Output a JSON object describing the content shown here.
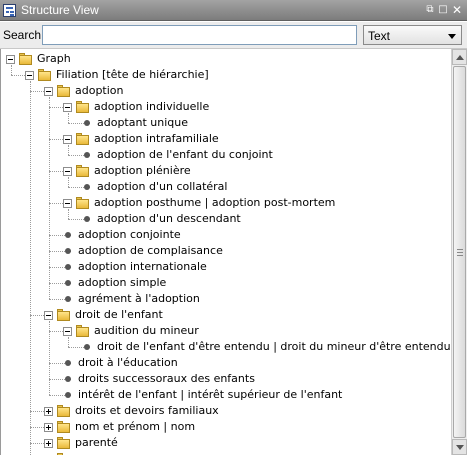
{
  "window": {
    "title": "Structure View"
  },
  "search": {
    "label": "Search",
    "value": "",
    "type_select": "Text"
  },
  "tree": [
    {
      "label": "Graph",
      "kind": "folder",
      "level": 0,
      "expander": "expanded"
    },
    {
      "label": "Filiation [tête de hiérarchie]",
      "kind": "folder",
      "level": 1,
      "expander": "expanded"
    },
    {
      "label": "adoption",
      "kind": "folder",
      "level": 2,
      "expander": "expanded"
    },
    {
      "label": "adoption individuelle",
      "kind": "folder",
      "level": 3,
      "expander": "expanded"
    },
    {
      "label": "adoptant unique",
      "kind": "leaf",
      "level": 4
    },
    {
      "label": "adoption intrafamiliale",
      "kind": "folder",
      "level": 3,
      "expander": "expanded"
    },
    {
      "label": "adoption de l'enfant du conjoint",
      "kind": "leaf",
      "level": 4
    },
    {
      "label": "adoption plénière",
      "kind": "folder",
      "level": 3,
      "expander": "expanded"
    },
    {
      "label": "adoption d'un collatéral",
      "kind": "leaf",
      "level": 4
    },
    {
      "label": "adoption posthume | adoption post-mortem",
      "kind": "folder",
      "level": 3,
      "expander": "expanded"
    },
    {
      "label": "adoption d'un descendant",
      "kind": "leaf",
      "level": 4
    },
    {
      "label": "adoption conjointe",
      "kind": "leaf",
      "level": 3
    },
    {
      "label": "adoption de complaisance",
      "kind": "leaf",
      "level": 3
    },
    {
      "label": "adoption internationale",
      "kind": "leaf",
      "level": 3
    },
    {
      "label": "adoption simple",
      "kind": "leaf",
      "level": 3
    },
    {
      "label": "agrément à l'adoption",
      "kind": "leaf",
      "level": 3
    },
    {
      "label": "droit de l'enfant",
      "kind": "folder",
      "level": 2,
      "expander": "expanded"
    },
    {
      "label": "audition du mineur",
      "kind": "folder",
      "level": 3,
      "expander": "expanded"
    },
    {
      "label": "droit de l'enfant d'être entendu | droit du mineur d'être entendu",
      "kind": "leaf",
      "level": 4
    },
    {
      "label": "droit à l'éducation",
      "kind": "leaf",
      "level": 3
    },
    {
      "label": "droits successoraux des enfants",
      "kind": "leaf",
      "level": 3
    },
    {
      "label": "intérêt de l'enfant | intérêt supérieur de l'enfant",
      "kind": "leaf",
      "level": 3
    },
    {
      "label": "droits et devoirs familiaux",
      "kind": "folder",
      "level": 2,
      "expander": "collapsed"
    },
    {
      "label": "nom et prénom | nom",
      "kind": "folder",
      "level": 2,
      "expander": "collapsed"
    },
    {
      "label": "parenté",
      "kind": "folder",
      "level": 2,
      "expander": "collapsed"
    },
    {
      "label": "",
      "kind": "folder",
      "level": 2,
      "expander": "collapsed"
    }
  ]
}
